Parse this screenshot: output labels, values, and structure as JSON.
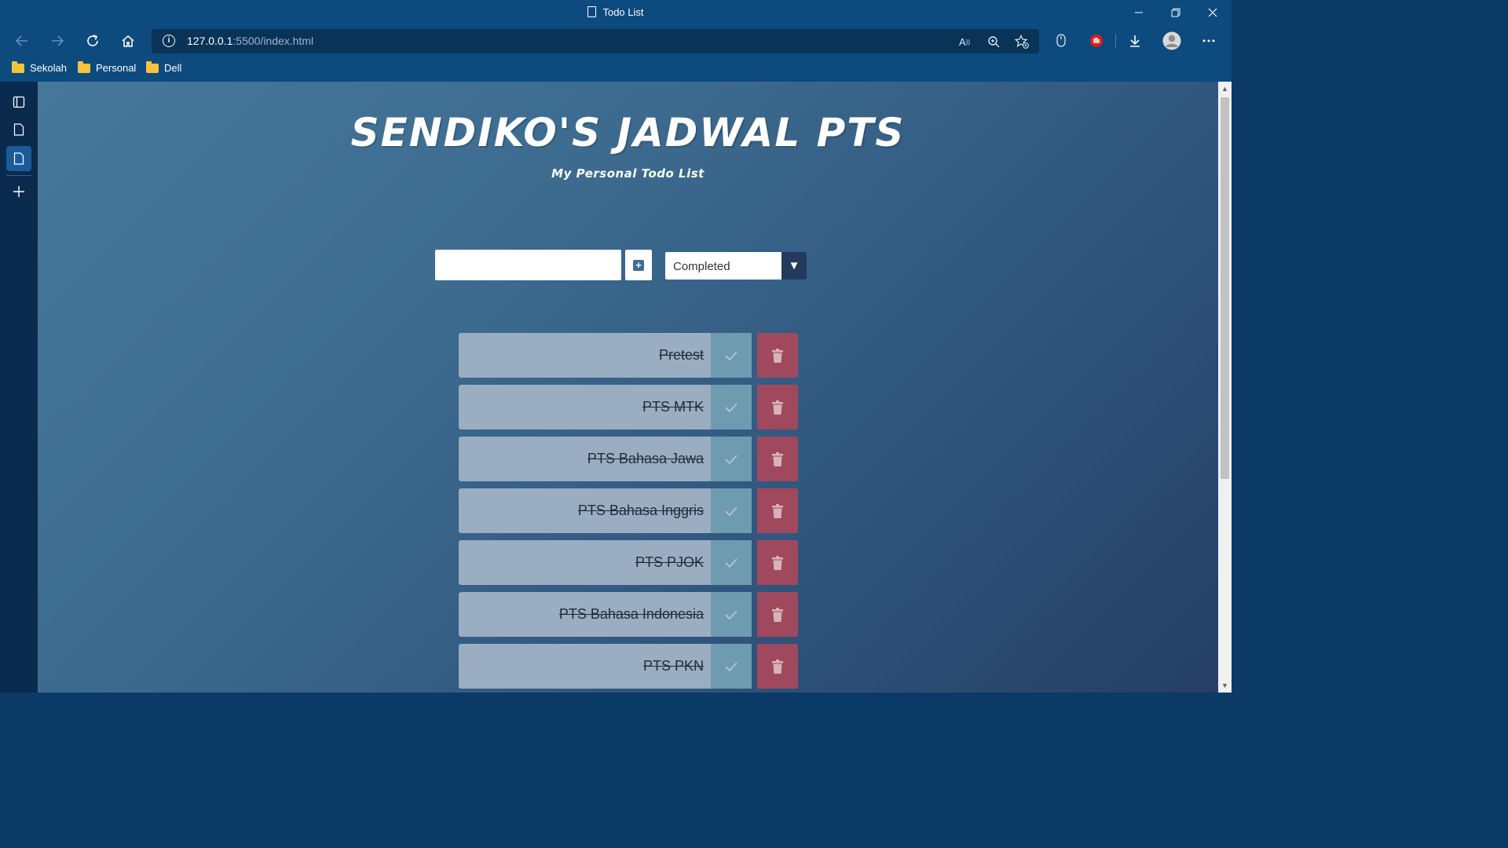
{
  "window": {
    "tab_title": "Todo List"
  },
  "toolbar": {
    "url_host": "127.0.0.1",
    "url_rest": ":5500/index.html"
  },
  "bookmarks": [
    {
      "label": "Sekolah"
    },
    {
      "label": "Personal"
    },
    {
      "label": "Dell"
    }
  ],
  "page": {
    "title": "Sendiko's Jadwal PTS",
    "subtitle": "My Personal Todo List",
    "input_value": "",
    "filter_selected": "Completed"
  },
  "todos": [
    {
      "text": "Pretest",
      "completed": true
    },
    {
      "text": "PTS MTK",
      "completed": true
    },
    {
      "text": "PTS Bahasa Jawa",
      "completed": true
    },
    {
      "text": "PTS Bahasa Inggris",
      "completed": true
    },
    {
      "text": "PTS PJOK",
      "completed": true
    },
    {
      "text": "PTS Bahasa Indonesia",
      "completed": true
    },
    {
      "text": "PTS PKN",
      "completed": true
    }
  ],
  "colors": {
    "chrome": "#0d4a7e",
    "item_bg": "#9aadc1",
    "check_bg": "#6f9bb0",
    "trash_bg": "#a0495e"
  }
}
